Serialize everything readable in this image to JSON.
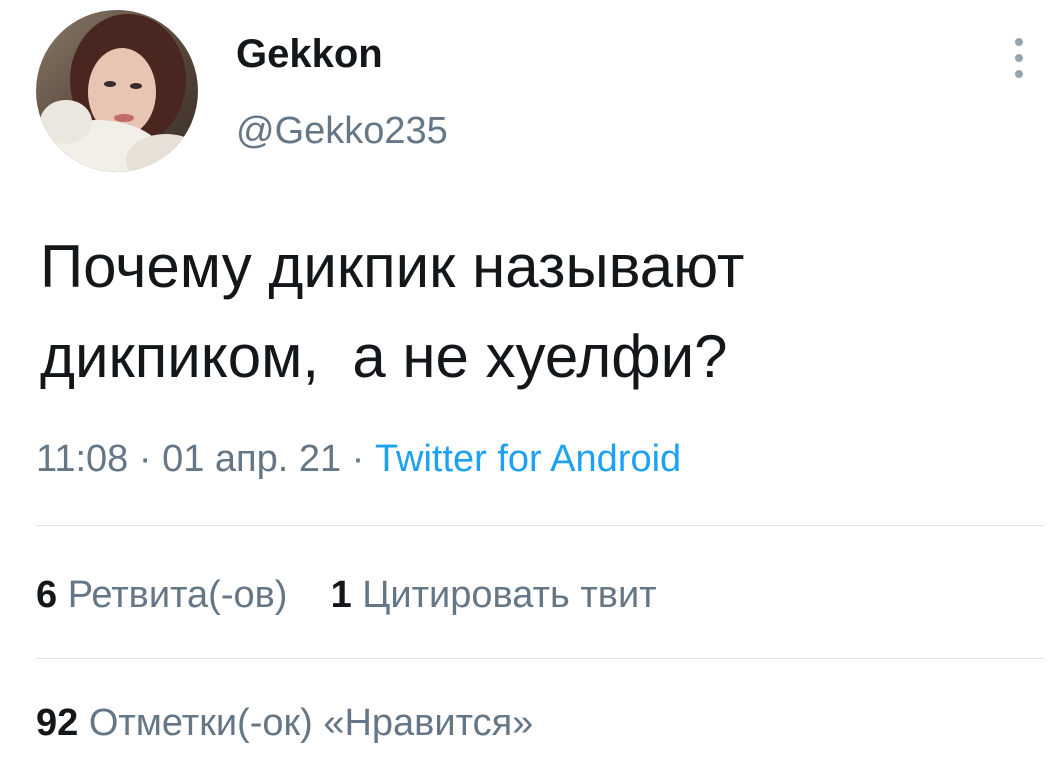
{
  "user": {
    "display_name": "Gekkon",
    "handle": "@Gekko235"
  },
  "tweet": {
    "line1": "Почему дикпик называют",
    "line2": "дикпиком,  а не хуелфи?"
  },
  "meta": {
    "time": "11:08",
    "sep1": " · ",
    "date": "01 апр. 21",
    "sep2": " · ",
    "source": "Twitter for Android"
  },
  "stats": {
    "retweets_count": "6",
    "retweets_label": "Ретвита(-ов)",
    "quotes_count": "1",
    "quotes_label": "Цитировать твит",
    "likes_count": "92",
    "likes_label": "Отметки(-ок) «Нравится»"
  },
  "colors": {
    "text_primary": "#14171a",
    "text_secondary": "#657786",
    "link": "#1da1f2",
    "divider": "#dfe3e6"
  },
  "icons": {
    "more": "more-vertical-icon"
  }
}
